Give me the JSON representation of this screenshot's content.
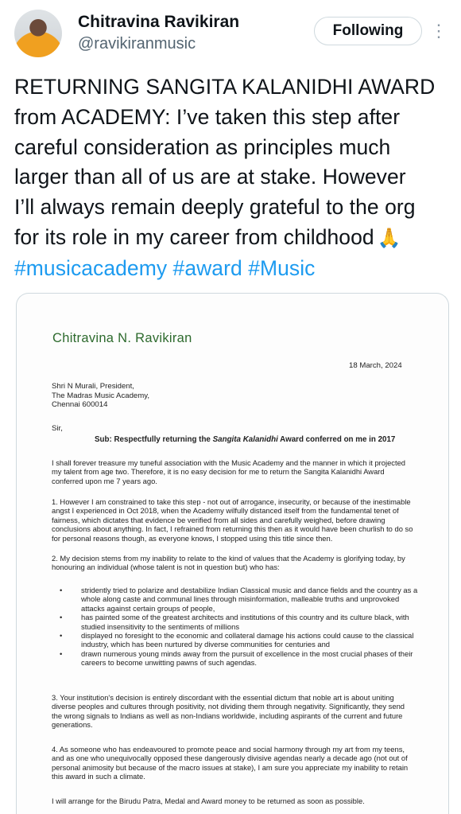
{
  "author": {
    "name": "Chitravina Ravikiran",
    "handle": "@ravikiranmusic",
    "follow_label": "Following",
    "more_icon": "⋮"
  },
  "tweet": {
    "lines": [
      "RETURNING SANGITA KALANIDHI AWARD",
      "from ACADEMY:  I’ve taken this step after",
      "careful consideration as principles much",
      "larger than all of us are at stake. However",
      "I’ll always remain deeply grateful to the org",
      "for its role in my career from childhood"
    ],
    "emoji": "🙏",
    "hashtags": [
      "#musicacademy",
      "#award",
      "#Music"
    ]
  },
  "letter": {
    "letterhead": "Chitravina N. Ravikiran",
    "date": "18 March, 2024",
    "address": [
      "Shri N Murali, President,",
      "The Madras Music Academy,",
      "Chennai 600014"
    ],
    "salutation": "Sir,",
    "subject_prefix": "Sub: Respectfully returning the ",
    "subject_award": "Sangita Kalanidhi",
    "subject_suffix": " Award conferred on me in 2017",
    "para1": [
      "I shall forever treasure my tuneful association with the Music Academy and the manner in which it projected",
      "my talent from age two. Therefore, it is no easy decision for me to return the Sangita Kalanidhi Award",
      "conferred upon me 7 years ago."
    ],
    "para2": [
      "1. However I am constrained to take this step - not out of arrogance, insecurity, or because of the inestimable",
      "angst I experienced in Oct 2018, when the Academy wilfully distanced itself from the fundamental tenet of",
      "fairness, which dictates that evidence be verified from all sides and carefully weighed, before drawing",
      "conclusions about anything. In fact, I refrained from returning this then as it would have been churlish to do so",
      "for personal reasons though, as everyone knows, I stopped using this title since then."
    ],
    "para3": [
      "2. My decision stems from my inability to relate to the kind of values that the Academy is glorifying today, by",
      "honouring an individual (whose talent is not in question but) who has:"
    ],
    "bullets": [
      [
        "stridently tried to polarize and destabilize Indian Classical music and dance fields and the country as a",
        "whole along caste and communal lines through misinformation, malleable truths and unprovoked",
        "attacks against certain groups of people,"
      ],
      [
        "has painted some of the greatest architects and institutions of this country and its culture black, with",
        "studied insensitivity to the sentiments of millions"
      ],
      [
        "displayed no foresight to the economic and collateral damage his actions could cause to the classical",
        "industry, which has been nurtured by diverse communities for centuries and"
      ],
      [
        "drawn numerous young minds away from the pursuit of excellence in the most crucial phases of their",
        "careers to become unwitting pawns of such agendas."
      ]
    ],
    "para4": [
      "3. Your institution's decision is entirely discordant with the essential dictum that noble art is about uniting",
      "diverse peoples and cultures through positivity, not dividing them through negativity. Significantly, they send",
      "the wrong signals to Indians as well as non-Indians worldwide, including aspirants of the current and future",
      "generations."
    ],
    "para5": [
      "4. As someone who has endeavoured to promote peace and social harmony through my art from my teens,",
      "and as one who unequivocally opposed these dangerously divisive agendas nearly a decade ago (not out of",
      "personal animosity but because of the macro issues at stake), I am sure you appreciate my inability to retain",
      "this award in such a climate."
    ],
    "para6": [
      "I will arrange for the Birudu Patra, Medal and Award money to be returned as soon as possible."
    ]
  }
}
